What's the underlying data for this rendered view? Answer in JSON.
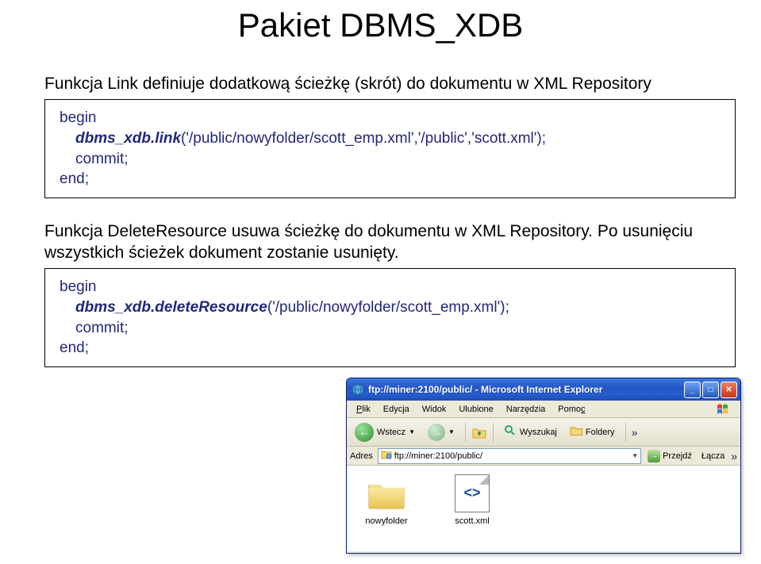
{
  "title": "Pakiet DBMS_XDB",
  "para1": "Funkcja Link definiuje dodatkową ścieżkę (skrót) do dokumentu w XML Repository",
  "code1": {
    "l1": "begin",
    "l2a": "dbms_xdb.link",
    "l2b": "('/public/nowyfolder/scott_emp.xml','/public','scott.xml');",
    "l3": "commit;",
    "l4": "end;"
  },
  "para2": "Funkcja DeleteResource usuwa ścieżkę do dokumentu w XML Repository. Po usunięciu wszystkich ścieżek dokument zostanie usunięty.",
  "code2": {
    "l1": "begin",
    "l2a": "dbms_xdb.deleteResource",
    "l2b": "('/public/nowyfolder/scott_emp.xml');",
    "l3": "commit;",
    "l4": "end;"
  },
  "browser": {
    "title": "ftp://miner:2100/public/ - Microsoft Internet Explorer",
    "menu": {
      "m1": "Plik",
      "m2": "Edycja",
      "m3": "Widok",
      "m4": "Ulubione",
      "m5": "Narzędzia",
      "m6": "Pomoc"
    },
    "toolbar": {
      "back": "Wstecz",
      "search": "Wyszukaj",
      "folders": "Foldery"
    },
    "addr": {
      "label": "Adres",
      "url": "ftp://miner:2100/public/",
      "go": "Przejdź",
      "links": "Łącza"
    },
    "items": {
      "folder": "nowyfolder",
      "file": "scott.xml"
    }
  }
}
